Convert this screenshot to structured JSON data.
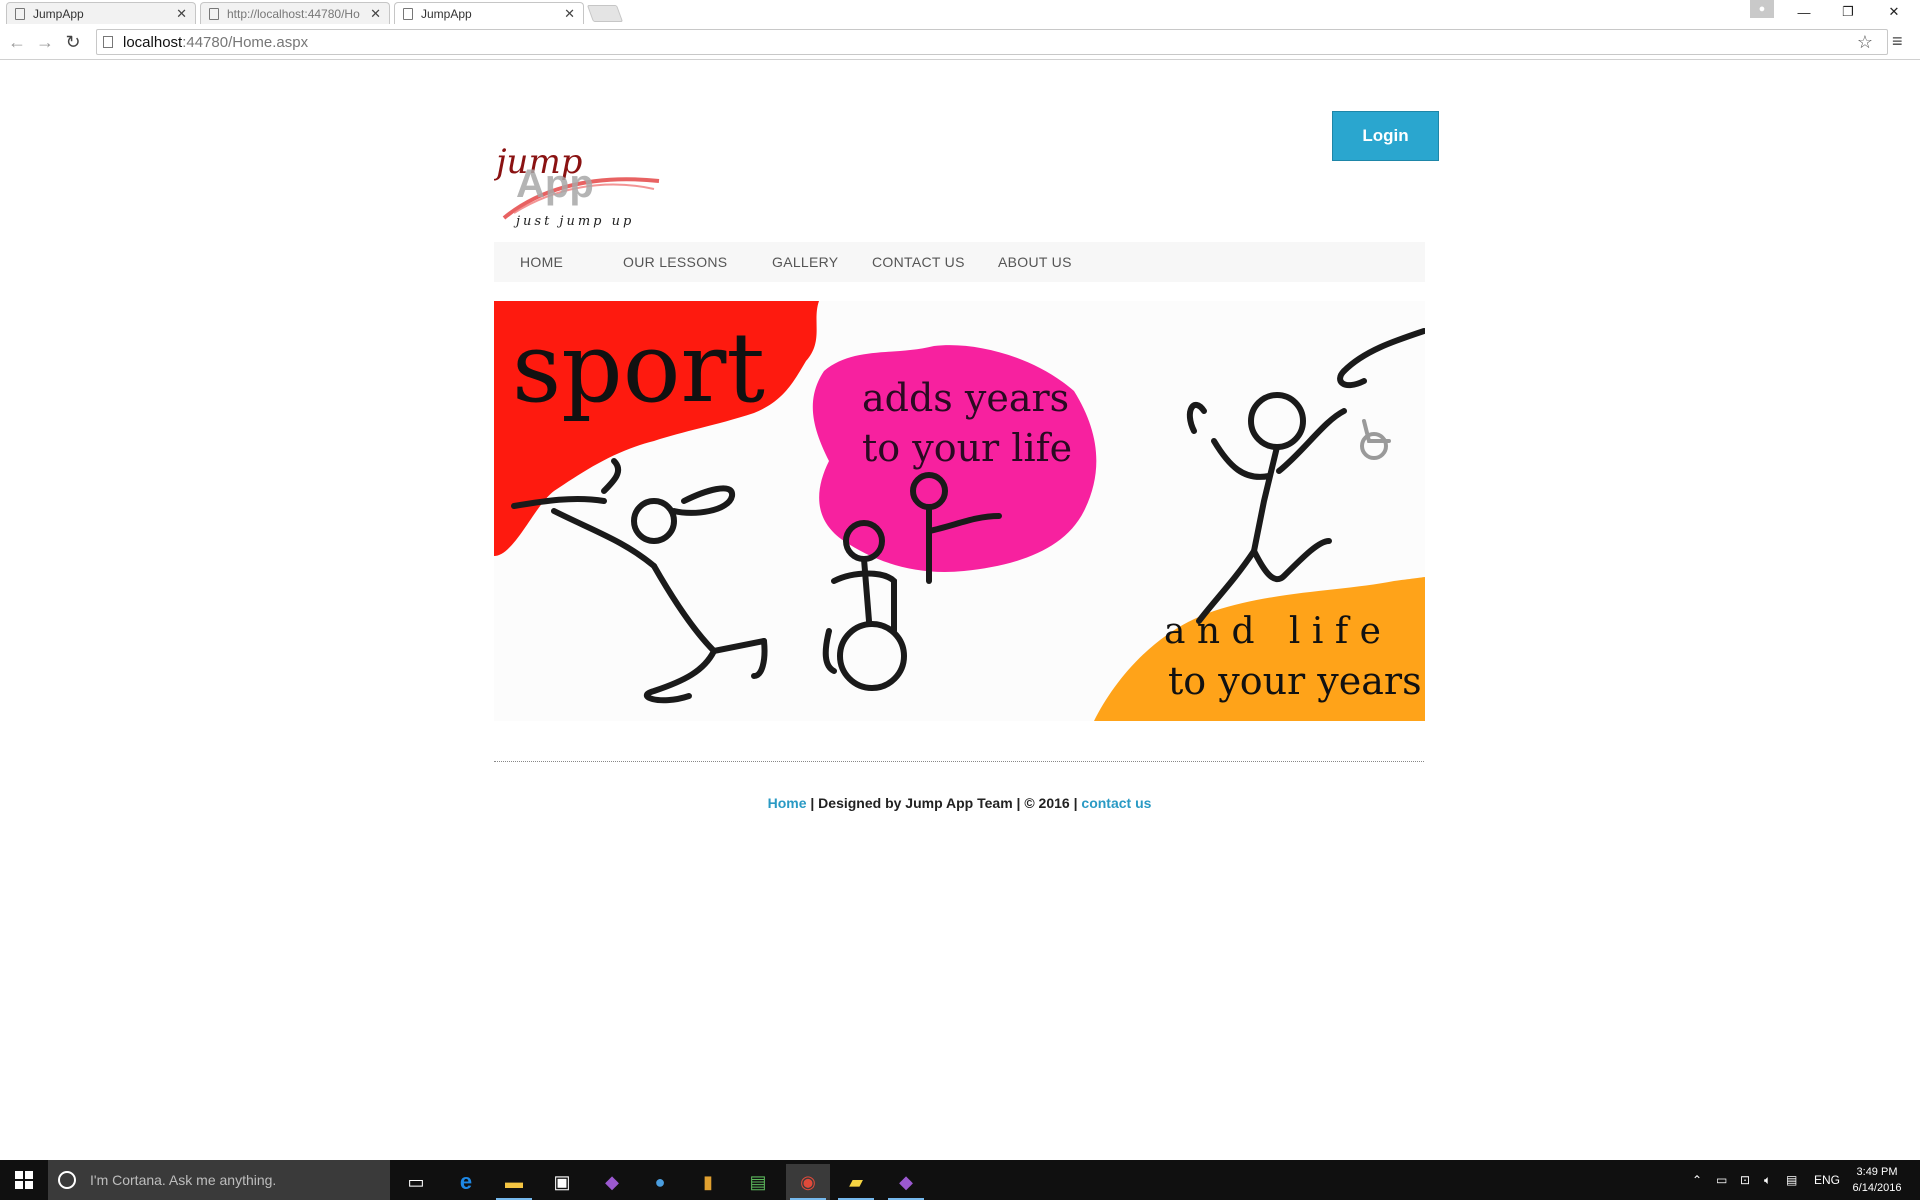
{
  "browser": {
    "tabs": [
      {
        "title": "JumpApp",
        "active": false
      },
      {
        "title": "http://localhost:44780/Ho",
        "active": false
      },
      {
        "title": "JumpApp",
        "active": true
      }
    ],
    "url_host": "localhost",
    "url_rest": ":44780/Home.aspx"
  },
  "page": {
    "logo": {
      "line1": "jump",
      "line2": "App",
      "tagline": "just jump up"
    },
    "login_label": "Login",
    "nav": [
      "HOME",
      "OUR LESSONS",
      "GALLERY",
      "CONTACT US",
      "ABOUT US"
    ],
    "banner": {
      "word1": "sport",
      "line2a": "adds years",
      "line2b": "to your life",
      "line3a": "a n d   l i f e",
      "line3b": "to your years",
      "colors": {
        "red": "#fe1a0f",
        "pink": "#f7219f",
        "orange": "#ffa319"
      }
    },
    "footer": {
      "home_link": "Home",
      "middle": " | Designed by Jump App Team | © 2016 | ",
      "contact_link": "contact us"
    }
  },
  "taskbar": {
    "cortana_placeholder": "I'm Cortana. Ask me anything.",
    "lang": "ENG",
    "time": "3:49 PM",
    "date": "6/14/2016"
  },
  "colors": {
    "accent": "#2aa6cf",
    "link": "#2a9ac4",
    "nav_bg": "#f7f7f7"
  }
}
